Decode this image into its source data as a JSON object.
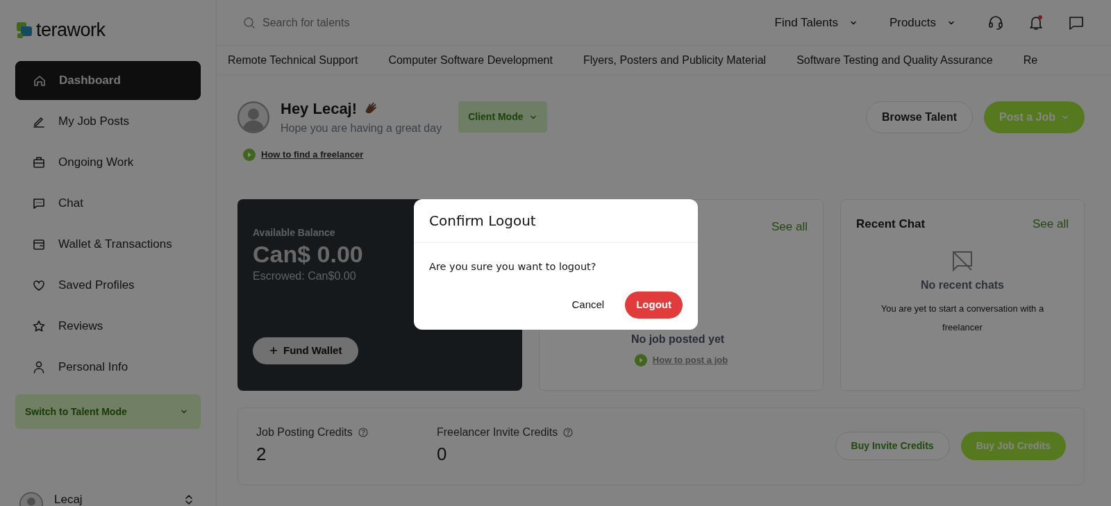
{
  "logo": {
    "text": "terawork"
  },
  "sidebar": {
    "items": [
      {
        "label": "Dashboard",
        "selected": true
      },
      {
        "label": "My Job Posts",
        "selected": false
      },
      {
        "label": "Ongoing Work",
        "selected": false
      },
      {
        "label": "Chat",
        "selected": false
      },
      {
        "label": "Wallet & Transactions",
        "selected": false
      },
      {
        "label": "Saved Profiles",
        "selected": false
      },
      {
        "label": "Reviews",
        "selected": false
      },
      {
        "label": "Personal Info",
        "selected": false
      }
    ],
    "mode_switch": {
      "label": "Switch to Talent Mode",
      "expanded": false
    },
    "user": {
      "name": "Lecaj"
    }
  },
  "topbar": {
    "search": {
      "placeholder": "Search for talents"
    },
    "menus": [
      "Find Talents",
      "Products"
    ],
    "notifications_unread": true
  },
  "categories": [
    "Remote Technical Support",
    "Computer Software Development",
    "Flyers, Posters and Publicity Material",
    "Software Testing and Quality Assurance",
    "Re"
  ],
  "greeting": {
    "title": "Hey Lecaj!",
    "subtitle": "Hope you are having a great day",
    "mode_button": "Client Mode",
    "tutorial_link": "How to find a freelancer",
    "actions": [
      {
        "label": "Browse Talent",
        "kind": "outline"
      },
      {
        "label": "Post a Job",
        "kind": "solid"
      }
    ]
  },
  "balance_card": {
    "label": "Available Balance",
    "amount": "Can$ 0.00",
    "escrowed": "Escrowed: Can$0.00",
    "button": "Fund Wallet"
  },
  "jobs_card": {
    "see_all": "See all",
    "empty_title": "No job posted yet",
    "link": "How to post a job"
  },
  "chat_card": {
    "title": "Recent Chat",
    "see_all": "See all",
    "empty_title": "No recent chats",
    "empty_text": "You are yet to start a conversation with a freelancer"
  },
  "credits": {
    "items": [
      {
        "label": "Job Posting Credits",
        "value": "2"
      },
      {
        "label": "Freelancer Invite Credits",
        "value": "0"
      }
    ],
    "buttons": [
      {
        "label": "Buy Invite Credits",
        "kind": "outline"
      },
      {
        "label": "Buy Job Credits",
        "kind": "solid"
      }
    ]
  },
  "modal": {
    "title": "Confirm Logout",
    "message": "Are you sure you want to logout?",
    "buttons": [
      {
        "label": "Cancel",
        "kind": "plain"
      },
      {
        "label": "Logout",
        "kind": "danger"
      }
    ]
  }
}
